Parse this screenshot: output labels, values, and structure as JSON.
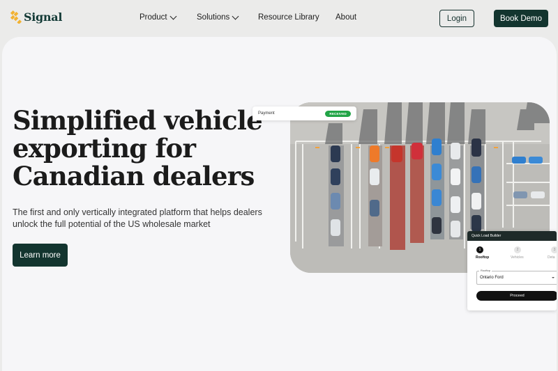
{
  "brand": {
    "name": "Signal"
  },
  "nav": {
    "items": [
      {
        "label": "Product"
      },
      {
        "label": "Solutions"
      },
      {
        "label": "Resource Library"
      },
      {
        "label": "About"
      }
    ],
    "login_label": "Login",
    "demo_label": "Book Demo"
  },
  "hero": {
    "headline_lines": [
      "Simplified vehicle",
      "exporting for",
      "Canadian dealers"
    ],
    "subtitle_lines": [
      "The first and only vertically integrated platform that helps dealers",
      "unlock the full potential of the US wholesale market"
    ],
    "cta_label": "Learn more"
  },
  "payment_card": {
    "label": "Payment",
    "status": "RECEIVED"
  },
  "quick_load": {
    "title": "Quick Load Builder",
    "steps": [
      {
        "num": "1",
        "label": "Rooftop"
      },
      {
        "num": "2",
        "label": "Vehicles"
      },
      {
        "num": "3",
        "label": "Deta"
      }
    ],
    "field_label": "Rooftop",
    "field_value": "Ontario Ford",
    "button_label": "Proceed"
  },
  "colors": {
    "brand_dark": "#13352f",
    "logo_gold": "#f2b233",
    "badge_green": "#22a447"
  }
}
